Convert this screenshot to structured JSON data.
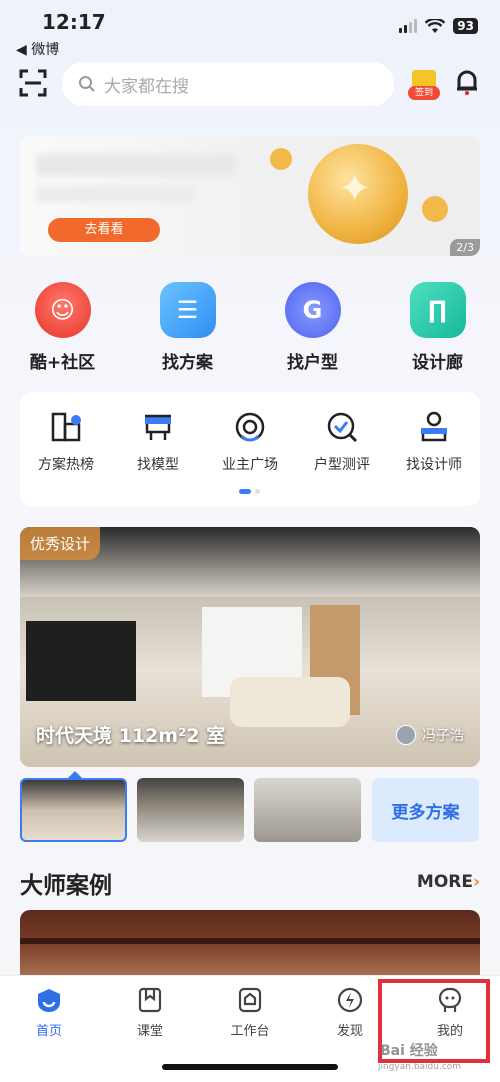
{
  "status": {
    "time": "12:17",
    "back_app": "◀ 微博",
    "battery": "93"
  },
  "search": {
    "placeholder": "大家都在搜",
    "gift_badge": "签到"
  },
  "banner": {
    "button": "去看看",
    "pager": "2/3"
  },
  "main_nav": [
    {
      "label": "酷+社区",
      "icon": "community-icon",
      "color": "#f2453d"
    },
    {
      "label": "找方案",
      "icon": "plan-icon",
      "color": "#3ba3f5"
    },
    {
      "label": "找户型",
      "icon": "floorplan-icon",
      "color": "#5b72f2"
    },
    {
      "label": "设计廊",
      "icon": "gallery-icon",
      "color": "#1fc4a8"
    }
  ],
  "sub_nav": [
    {
      "label": "方案热榜",
      "icon": "ranking-icon"
    },
    {
      "label": "找模型",
      "icon": "model-icon"
    },
    {
      "label": "业主广场",
      "icon": "owner-plaza-icon"
    },
    {
      "label": "户型测评",
      "icon": "evaluation-icon"
    },
    {
      "label": "找设计师",
      "icon": "designer-icon"
    }
  ],
  "feature": {
    "tag": "优秀设计",
    "title": "时代天境 112m²2 室",
    "author": "冯子浩"
  },
  "thumbs": {
    "more": "更多方案"
  },
  "master": {
    "title": "大师案例",
    "more": "MORE",
    "more_arrow": "›"
  },
  "tabs": [
    {
      "label": "首页",
      "icon": "home-icon",
      "active": true
    },
    {
      "label": "课堂",
      "icon": "classroom-icon",
      "active": false
    },
    {
      "label": "工作台",
      "icon": "workbench-icon",
      "active": false
    },
    {
      "label": "发现",
      "icon": "discover-icon",
      "active": false
    },
    {
      "label": "我的",
      "icon": "profile-icon",
      "active": false
    }
  ],
  "watermark": {
    "main": "Bai 经验",
    "sub": "jingyan.baidu.com"
  }
}
